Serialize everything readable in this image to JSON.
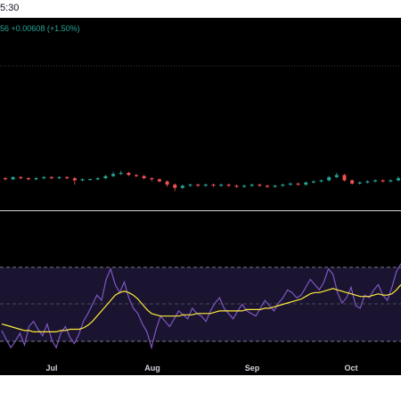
{
  "header": {
    "time_fragment": "5:30"
  },
  "quote": {
    "last_fragment": "56",
    "change": "+0.00608 (+1.50%)"
  },
  "colors": {
    "background": "#000000",
    "up": "#26a69a",
    "down": "#ef5350",
    "rsi_line": "#7e57c2",
    "rsi_ma": "#ffeb3b",
    "rsi_band": "#1a1430",
    "text": "#d1d4dc"
  },
  "x_axis": {
    "ticks": [
      "Jul",
      "Aug",
      "Sep",
      "Oct"
    ]
  },
  "rsi": {
    "upper_band": 70,
    "middle_band": 50,
    "lower_band": 30,
    "values": [
      35,
      28,
      22,
      27,
      33,
      24,
      38,
      42,
      36,
      31,
      40,
      28,
      22,
      33,
      38,
      30,
      25,
      32,
      42,
      48,
      55,
      62,
      58,
      74,
      82,
      70,
      64,
      72,
      60,
      52,
      48,
      40,
      34,
      22,
      36,
      46,
      42,
      38,
      44,
      50,
      47,
      44,
      52,
      48,
      46,
      42,
      50,
      56,
      60,
      52,
      48,
      44,
      50,
      55,
      50,
      48,
      46,
      52,
      58,
      54,
      50,
      56,
      60,
      66,
      64,
      60,
      62,
      68,
      74,
      70,
      66,
      72,
      82,
      78,
      64,
      56,
      60,
      68,
      54,
      52,
      62,
      60,
      66,
      70,
      62,
      58,
      68,
      80,
      86
    ],
    "ma": [
      40,
      39,
      38,
      37,
      36,
      35,
      35,
      34,
      34,
      34,
      34,
      34,
      34,
      35,
      35,
      36,
      36,
      36,
      37,
      39,
      42,
      46,
      50,
      54,
      58,
      62,
      64,
      65,
      64,
      62,
      59,
      55,
      51,
      48,
      47,
      46,
      46,
      46,
      46,
      46,
      47,
      47,
      47,
      48,
      48,
      48,
      48,
      49,
      50,
      50,
      50,
      50,
      50,
      50,
      51,
      51,
      51,
      51,
      52,
      52,
      53,
      54,
      55,
      56,
      57,
      58,
      59,
      61,
      63,
      64,
      64,
      65,
      66,
      67,
      66,
      65,
      64,
      63,
      62,
      61,
      61,
      61,
      62,
      63,
      62,
      62,
      63,
      66,
      70
    ]
  },
  "chart_data": {
    "type": "line",
    "x_ticks": [
      "Jul",
      "Aug",
      "Sep",
      "Oct"
    ],
    "series": [
      {
        "values": [
          35,
          28,
          22,
          27,
          33,
          24,
          38,
          42,
          36,
          31,
          40,
          28,
          22,
          33,
          38,
          30,
          25,
          32,
          42,
          48,
          55,
          62,
          58,
          74,
          82,
          70,
          64,
          72,
          60,
          52,
          48,
          40,
          34,
          22,
          36,
          46,
          42,
          38,
          44,
          50,
          47,
          44,
          52,
          48,
          46,
          42,
          50,
          56,
          60,
          52,
          48,
          44,
          50,
          55,
          50,
          48,
          46,
          52,
          58,
          54,
          50,
          56,
          60,
          66,
          64,
          60,
          62,
          68,
          74,
          70,
          66,
          72,
          82,
          78,
          64,
          56,
          60,
          68,
          54,
          52,
          62,
          60,
          66,
          70,
          62,
          58,
          68,
          80,
          86
        ]
      },
      {
        "values": [
          40,
          39,
          38,
          37,
          36,
          35,
          35,
          34,
          34,
          34,
          34,
          34,
          34,
          35,
          35,
          36,
          36,
          36,
          37,
          39,
          42,
          46,
          50,
          54,
          58,
          62,
          64,
          65,
          64,
          62,
          59,
          55,
          51,
          48,
          47,
          46,
          46,
          46,
          46,
          46,
          47,
          47,
          47,
          48,
          48,
          48,
          48,
          49,
          50,
          50,
          50,
          50,
          50,
          50,
          51,
          51,
          51,
          51,
          52,
          52,
          53,
          54,
          55,
          56,
          57,
          58,
          59,
          61,
          63,
          64,
          64,
          65,
          66,
          67,
          66,
          65,
          64,
          63,
          62,
          61,
          61,
          61,
          62,
          63,
          62,
          62,
          63,
          66,
          70
        ]
      }
    ],
    "bands": [
      70,
      50,
      30
    ]
  },
  "candles": [
    {
      "o": 0,
      "c": -1,
      "h": 1,
      "l": -2
    },
    {
      "o": -1,
      "c": 1,
      "h": 2,
      "l": -2
    },
    {
      "o": 1,
      "c": 0,
      "h": 2,
      "l": -1
    },
    {
      "o": 0,
      "c": -1,
      "h": 1,
      "l": -2
    },
    {
      "o": -1,
      "c": 0,
      "h": 1,
      "l": -2
    },
    {
      "o": 0,
      "c": 1,
      "h": 2,
      "l": -1
    },
    {
      "o": 1,
      "c": 0,
      "h": 2,
      "l": -1
    },
    {
      "o": 0,
      "c": 1,
      "h": 2,
      "l": -1
    },
    {
      "o": 1,
      "c": 0,
      "h": 2,
      "l": -1
    },
    {
      "o": 0,
      "c": -2,
      "h": 1,
      "l": -6
    },
    {
      "o": -2,
      "c": -1,
      "h": 0,
      "l": -3
    },
    {
      "o": -1,
      "c": -1,
      "h": 0,
      "l": -2
    },
    {
      "o": -1,
      "c": 0,
      "h": 1,
      "l": -2
    },
    {
      "o": 0,
      "c": 2,
      "h": 3,
      "l": -1
    },
    {
      "o": 2,
      "c": 4,
      "h": 6,
      "l": 1
    },
    {
      "o": 4,
      "c": 5,
      "h": 7,
      "l": 3
    },
    {
      "o": 5,
      "c": 3,
      "h": 6,
      "l": 2
    },
    {
      "o": 3,
      "c": 2,
      "h": 4,
      "l": 1
    },
    {
      "o": 2,
      "c": 0,
      "h": 3,
      "l": -1
    },
    {
      "o": 0,
      "c": -1,
      "h": 1,
      "l": -3
    },
    {
      "o": -1,
      "c": -3,
      "h": 0,
      "l": -4
    },
    {
      "o": -3,
      "c": -6,
      "h": -2,
      "l": -8
    },
    {
      "o": -6,
      "c": -9,
      "h": -5,
      "l": -12
    },
    {
      "o": -9,
      "c": -7,
      "h": -6,
      "l": -10
    },
    {
      "o": -7,
      "c": -6,
      "h": -5,
      "l": -8
    },
    {
      "o": -6,
      "c": -7,
      "h": -5,
      "l": -8
    },
    {
      "o": -7,
      "c": -6,
      "h": -5,
      "l": -8
    },
    {
      "o": -6,
      "c": -7,
      "h": -5,
      "l": -8
    },
    {
      "o": -7,
      "c": -6,
      "h": -5,
      "l": -8
    },
    {
      "o": -6,
      "c": -7,
      "h": -5,
      "l": -8
    },
    {
      "o": -7,
      "c": -8,
      "h": -6,
      "l": -9
    },
    {
      "o": -8,
      "c": -7,
      "h": -6,
      "l": -9
    },
    {
      "o": -7,
      "c": -6,
      "h": -5,
      "l": -8
    },
    {
      "o": -6,
      "c": -7,
      "h": -5,
      "l": -8
    },
    {
      "o": -7,
      "c": -8,
      "h": -6,
      "l": -9
    },
    {
      "o": -8,
      "c": -7,
      "h": -6,
      "l": -9
    },
    {
      "o": -7,
      "c": -6,
      "h": -5,
      "l": -8
    },
    {
      "o": -6,
      "c": -5,
      "h": -4,
      "l": -7
    },
    {
      "o": -5,
      "c": -6,
      "h": -4,
      "l": -7
    },
    {
      "o": -6,
      "c": -4,
      "h": -3,
      "l": -7
    },
    {
      "o": -4,
      "c": -3,
      "h": -2,
      "l": -5
    },
    {
      "o": -3,
      "c": -2,
      "h": -1,
      "l": -4
    },
    {
      "o": -2,
      "c": 1,
      "h": 2,
      "l": -3
    },
    {
      "o": 1,
      "c": 3,
      "h": 5,
      "l": 0
    },
    {
      "o": 3,
      "c": -2,
      "h": 4,
      "l": -3
    },
    {
      "o": -2,
      "c": -5,
      "h": -1,
      "l": -6
    },
    {
      "o": -5,
      "c": -4,
      "h": -3,
      "l": -6
    },
    {
      "o": -4,
      "c": -3,
      "h": -2,
      "l": -5
    },
    {
      "o": -3,
      "c": -2,
      "h": -1,
      "l": -4
    },
    {
      "o": -2,
      "c": -3,
      "h": -1,
      "l": -4
    },
    {
      "o": -3,
      "c": -2,
      "h": -1,
      "l": -4
    },
    {
      "o": -2,
      "c": 0,
      "h": 2,
      "l": -3
    }
  ]
}
